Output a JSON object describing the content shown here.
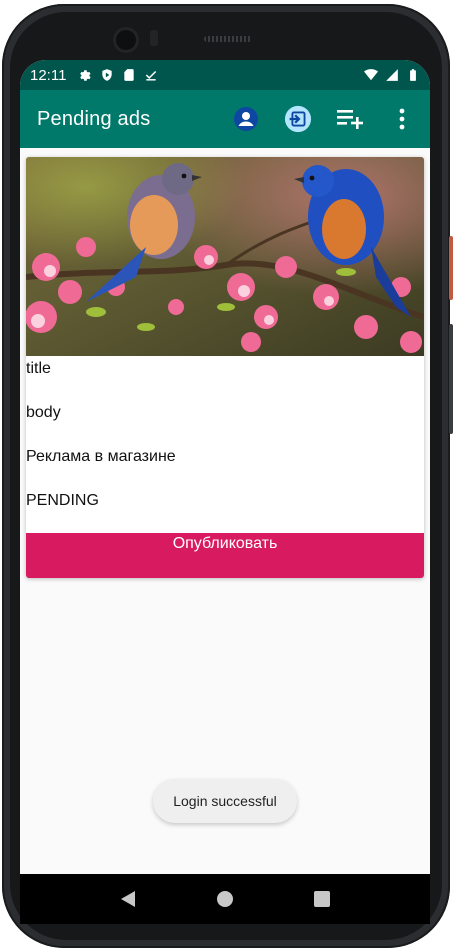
{
  "status_bar": {
    "time": "12:11",
    "icons_left": [
      "gear-icon",
      "shield-play-icon",
      "sd-card-icon",
      "download-done-icon"
    ],
    "icons_right": [
      "wifi-icon",
      "signal-icon",
      "battery-icon"
    ]
  },
  "app_bar": {
    "title": "Pending ads",
    "actions": [
      "account-icon",
      "login-icon",
      "playlist-add-icon",
      "overflow-menu-icon"
    ]
  },
  "ad_card": {
    "image": "bluebirds-on-blossom-branch",
    "title": "title",
    "body": "body",
    "category": "Реклама в магазине",
    "status": "PENDING",
    "publish_label": "Опубликовать"
  },
  "toast": {
    "message": "Login successful"
  },
  "nav_bar": {
    "buttons": [
      "back-icon",
      "home-icon",
      "recents-icon"
    ]
  },
  "colors": {
    "status_bar": "#00564d",
    "app_bar": "#00796b",
    "accent": "#d81b60",
    "background": "#fafafa"
  }
}
